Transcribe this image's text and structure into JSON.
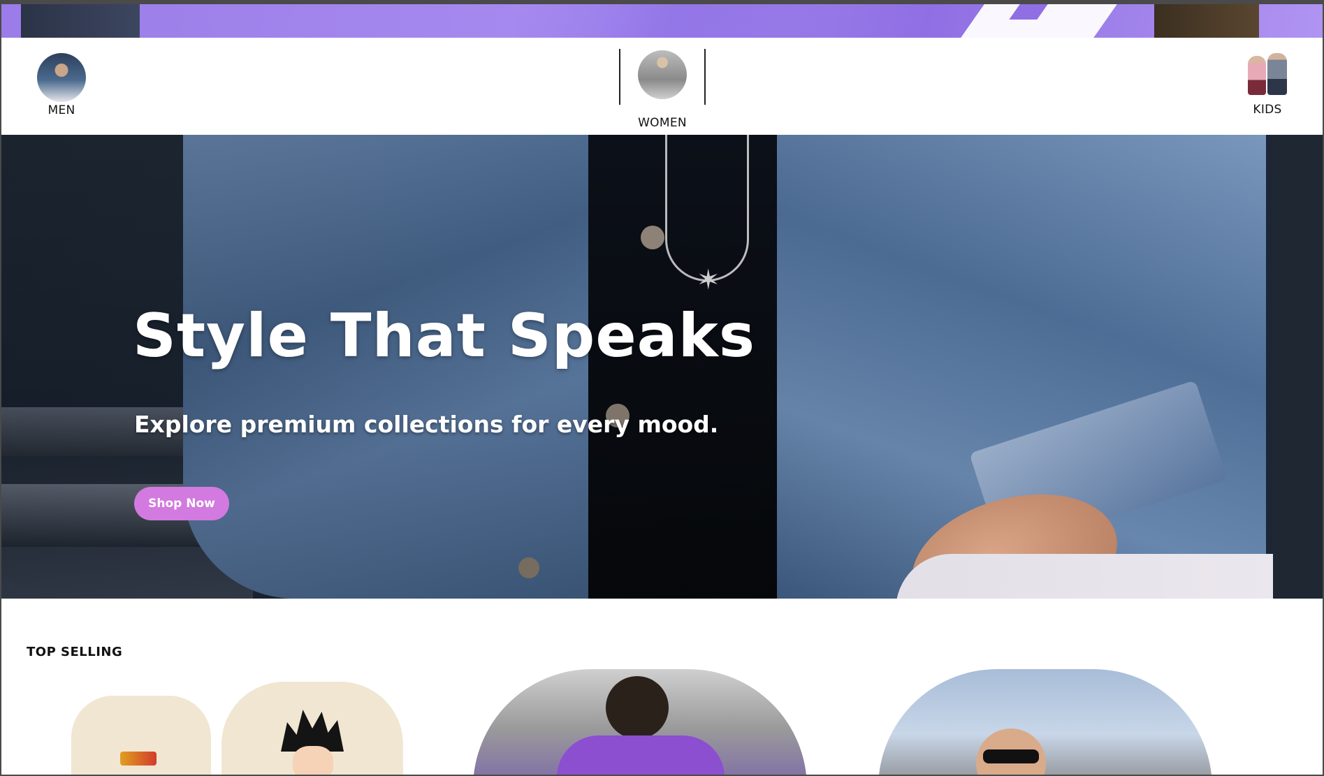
{
  "categories": [
    {
      "key": "men",
      "label": "MEN",
      "icon": "men-avatar"
    },
    {
      "key": "women",
      "label": "WOMEN",
      "icon": "women-avatar"
    },
    {
      "key": "kids",
      "label": "KIDS",
      "icon": "kids-avatar"
    }
  ],
  "hero": {
    "title": "Style That Speaks",
    "subtitle": "Explore premium collections for every mood.",
    "cta_label": "Shop Now",
    "cta_color": "#d27adf"
  },
  "top_selling": {
    "title": "TOP SELLING"
  },
  "colors": {
    "promo_strip": "#a78bf0",
    "background": "#ffffff",
    "text": "#111111"
  }
}
